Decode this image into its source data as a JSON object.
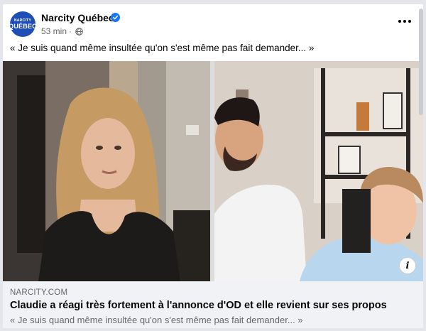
{
  "post": {
    "page_name": "Narcity Québec",
    "avatar": {
      "line1": "NARCITY",
      "line2": "QUÉBEC"
    },
    "time": "53 min",
    "separator": "·",
    "caption": "« Je suis quand même insultée qu'on s'est même pas fait demander... »"
  },
  "link": {
    "domain": "NARCITY.COM",
    "title": "Claudie a réagi très fortement à l'annonce d'OD et elle revient sur ses propos",
    "description": "« Je suis quand même insultée qu'on s'est même pas fait demander... »"
  },
  "icons": {
    "verified": "verified-badge-icon",
    "privacy": "globe-icon",
    "more": "more-options-icon",
    "info": "info-icon"
  },
  "colors": {
    "brand": "#1e4db7",
    "verified": "#1877f2",
    "secondary_text": "#65676b",
    "link_background": "#f0f2f5"
  }
}
